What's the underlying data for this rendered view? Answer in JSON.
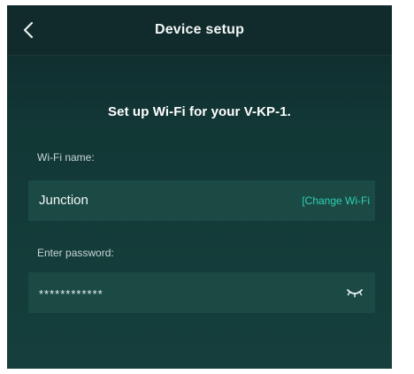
{
  "header": {
    "title": "Device setup",
    "back_icon": "back-chevron-icon"
  },
  "main": {
    "heading": "Set up Wi-Fi for your V-KP-1.",
    "wifi": {
      "label": "Wi-Fi name:",
      "network": "Junction",
      "change_label": "[Change Wi-Fi"
    },
    "password": {
      "label": "Enter password:",
      "value": "************",
      "toggle_icon": "eye-closed-icon"
    }
  },
  "colors": {
    "background": "#123836",
    "header": "#112a2b",
    "field": "#1b4a44",
    "accent": "#2fd0b5"
  }
}
